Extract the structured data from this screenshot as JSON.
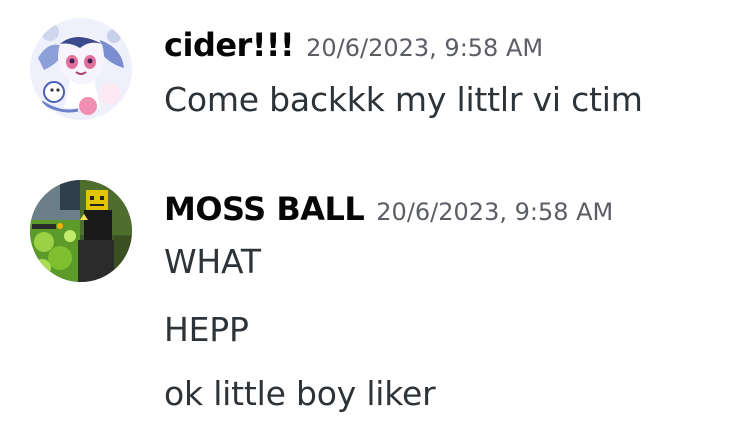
{
  "messages": [
    {
      "username": "cider!!!",
      "timestamp": "20/6/2023, 9:58 AM",
      "avatar_icon": "anime-character-avatar-icon",
      "lines": [
        "Come backkk my littlr vi ctim"
      ]
    },
    {
      "username": "MOSS BALL",
      "timestamp": "20/6/2023, 9:58 AM",
      "avatar_icon": "game-screenshot-avatar-icon",
      "lines": [
        "WHAT",
        "HEPP",
        "ok little boy liker"
      ]
    }
  ],
  "colors": {
    "background": "#ffffff",
    "username": "#060607",
    "timestamp": "#5c5e66",
    "message_text": "#2e3338"
  }
}
